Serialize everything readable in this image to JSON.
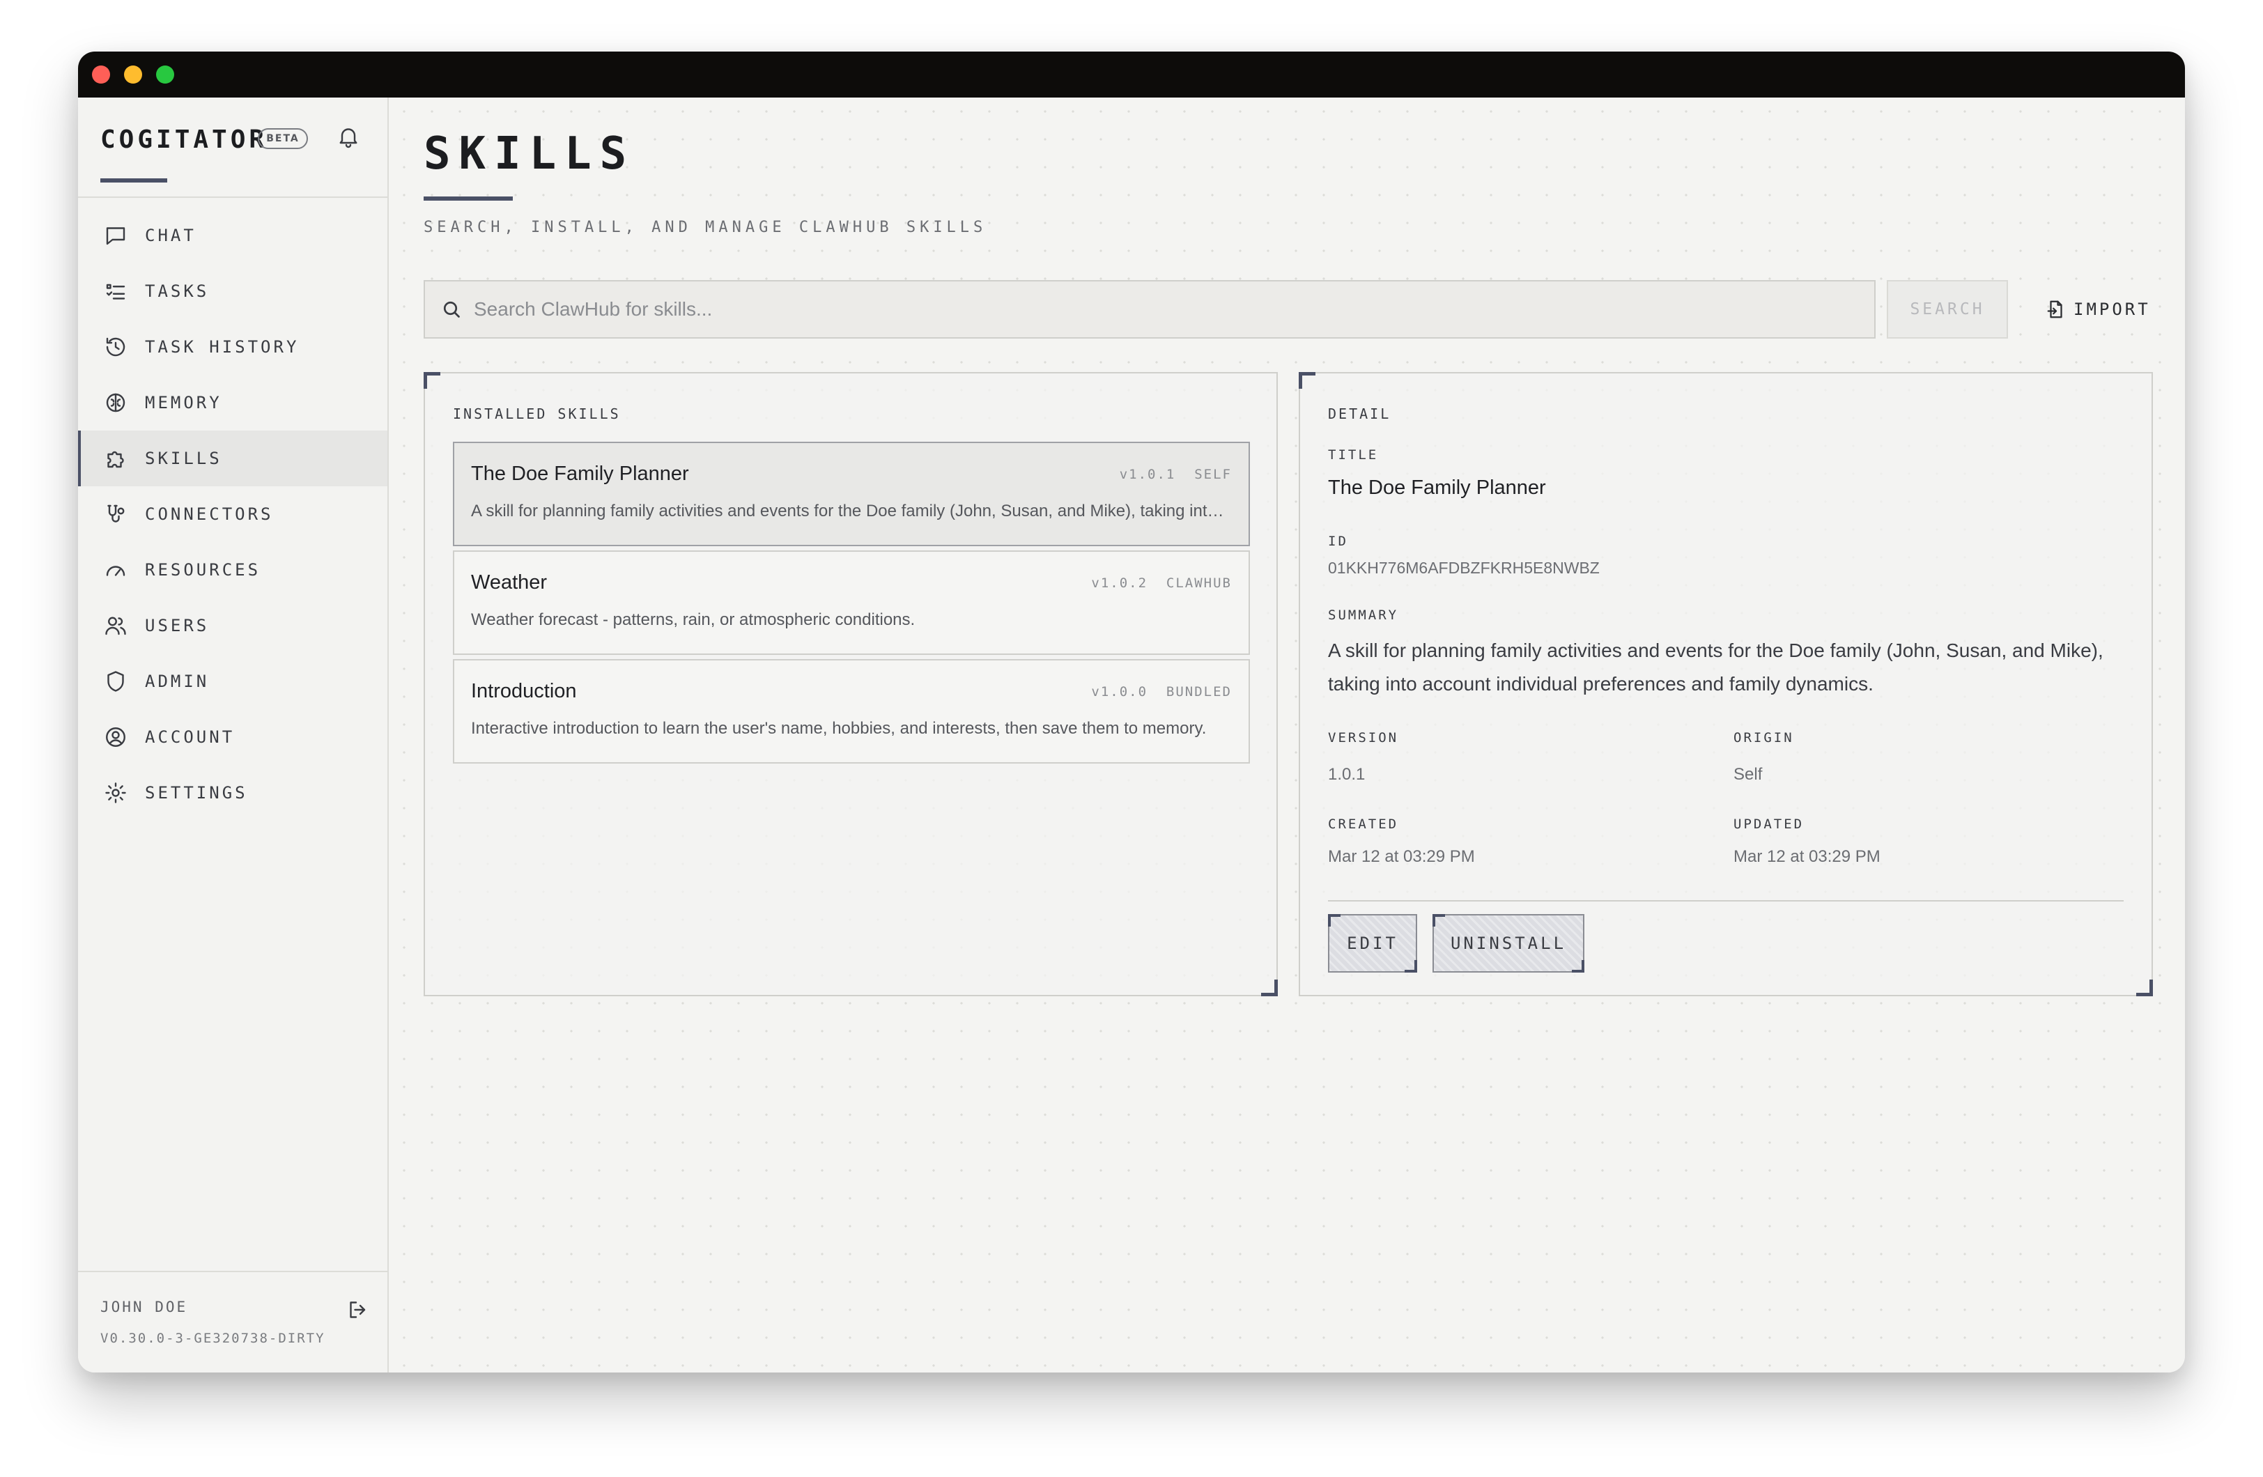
{
  "app": {
    "name": "COGITATOR",
    "badge": "BETA"
  },
  "sidebar": {
    "items": [
      {
        "label": "CHAT",
        "icon": "chat-bubble-icon"
      },
      {
        "label": "TASKS",
        "icon": "task-list-icon"
      },
      {
        "label": "TASK HISTORY",
        "icon": "history-icon"
      },
      {
        "label": "MEMORY",
        "icon": "brain-icon"
      },
      {
        "label": "SKILLS",
        "icon": "puzzle-icon",
        "active": true
      },
      {
        "label": "CONNECTORS",
        "icon": "connector-icon"
      },
      {
        "label": "RESOURCES",
        "icon": "gauge-icon"
      },
      {
        "label": "USERS",
        "icon": "users-icon"
      },
      {
        "label": "ADMIN",
        "icon": "shield-icon"
      },
      {
        "label": "ACCOUNT",
        "icon": "user-circle-icon"
      },
      {
        "label": "SETTINGS",
        "icon": "gear-icon"
      }
    ],
    "user": "JOHN DOE",
    "version": "V0.30.0-3-GE320738-DIRTY"
  },
  "page": {
    "title": "SKILLS",
    "subtitle": "SEARCH, INSTALL, AND MANAGE CLAWHUB SKILLS"
  },
  "search": {
    "placeholder": "Search ClawHub for skills...",
    "value": "",
    "button_label": "SEARCH",
    "import_label": "IMPORT"
  },
  "installed": {
    "heading": "INSTALLED SKILLS",
    "skills": [
      {
        "title": "The Doe Family Planner",
        "version": "v1.0.1",
        "origin": "SELF",
        "description": "A skill for planning family activities and events for the Doe family (John, Susan, and Mike), taking into account individual preferences and family dynamics.",
        "selected": true
      },
      {
        "title": "Weather",
        "version": "v1.0.2",
        "origin": "CLAWHUB",
        "description": "Weather forecast - patterns, rain, or atmospheric conditions."
      },
      {
        "title": "Introduction",
        "version": "v1.0.0",
        "origin": "BUNDLED",
        "description": "Interactive introduction to learn the user's name, hobbies, and interests, then save them to memory."
      }
    ]
  },
  "detail": {
    "heading": "DETAIL",
    "title_label": "TITLE",
    "title": "The Doe Family Planner",
    "id_label": "ID",
    "id": "01KKH776M6AFDBZFKRH5E8NWBZ",
    "summary_label": "SUMMARY",
    "summary": "A skill for planning family activities and events for the Doe family (John, Susan, and Mike), taking into account individual preferences and family dynamics.",
    "version_label": "VERSION",
    "version": "1.0.1",
    "origin_label": "ORIGIN",
    "origin": "Self",
    "created_label": "CREATED",
    "created": "Mar 12 at 03:29 PM",
    "updated_label": "UPDATED",
    "updated": "Mar 12 at 03:29 PM",
    "edit_label": "EDIT",
    "uninstall_label": "UNINSTALL"
  },
  "colors": {
    "accent": "#4a5066",
    "background": "#f4f4f2",
    "titlebar": "#0d0c0a"
  }
}
